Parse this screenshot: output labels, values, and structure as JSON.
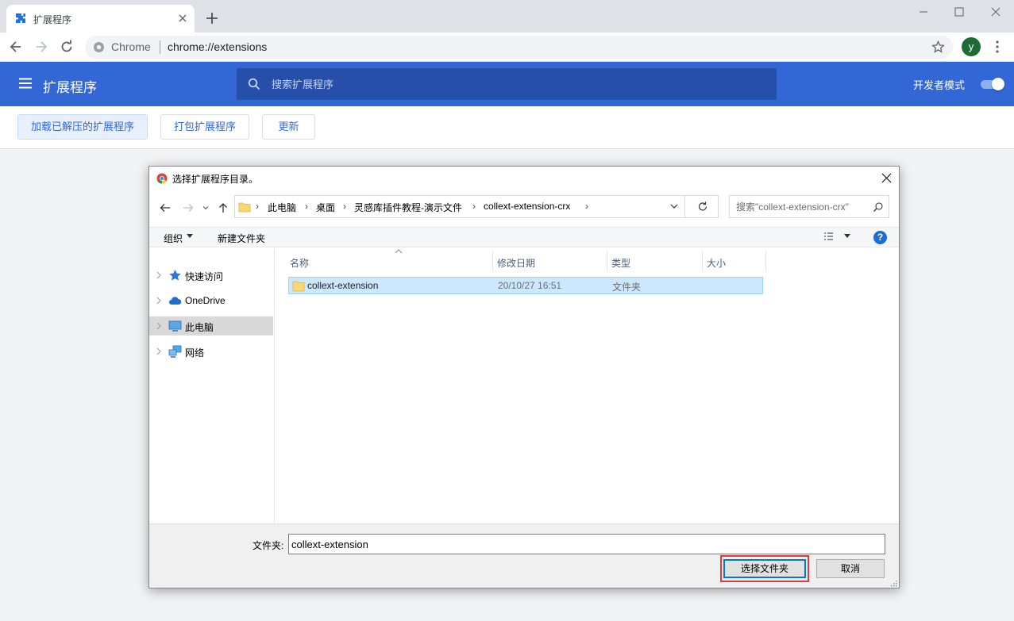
{
  "browser": {
    "tab": {
      "title": "扩展程序"
    },
    "omnibox": {
      "scheme_label": "Chrome",
      "url": "chrome://extensions"
    },
    "profile_initial": "y"
  },
  "extensions_page": {
    "title": "扩展程序",
    "search_placeholder": "搜索扩展程序",
    "dev_mode_label": "开发者模式",
    "dev_mode_on": true,
    "buttons": {
      "load_unpacked": "加载已解压的扩展程序",
      "pack": "打包扩展程序",
      "update": "更新"
    }
  },
  "dialog": {
    "title": "选择扩展程序目录。",
    "breadcrumbs": [
      "此电脑",
      "桌面",
      "灵感库插件教程-演示文件",
      "collext-extension-crx"
    ],
    "search_placeholder": "搜索\"collext-extension-crx\"",
    "commands": {
      "organize": "组织",
      "new_folder": "新建文件夹"
    },
    "help_label": "?",
    "nav_items": [
      {
        "label": "快速访问",
        "icon": "star-icon",
        "selected": false
      },
      {
        "label": "OneDrive",
        "icon": "cloud-icon",
        "selected": false
      },
      {
        "label": "此电脑",
        "icon": "computer-icon",
        "selected": true
      },
      {
        "label": "网络",
        "icon": "network-icon",
        "selected": false
      }
    ],
    "columns": [
      "名称",
      "修改日期",
      "类型",
      "大小"
    ],
    "files": [
      {
        "name": "collext-extension",
        "modified": "20/10/27 16:51",
        "type": "文件夹",
        "size": ""
      }
    ],
    "folder_label": "文件夹:",
    "folder_value": "collext-extension",
    "select_button": "选择文件夹",
    "cancel_button": "取消"
  },
  "colors": {
    "header_blue": "#3367d6",
    "search_bg": "#254fa8",
    "selection": "#cce8ff",
    "highlight_red": "#e53935"
  }
}
